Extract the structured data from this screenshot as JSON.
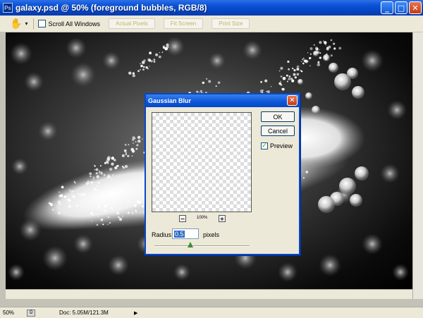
{
  "window": {
    "title": "galaxy.psd @ 50% (foreground bubbles, RGB/8)",
    "app_icon_text": "Ps",
    "minimize_glyph": "_",
    "maximize_glyph": "□",
    "close_glyph": "✕"
  },
  "options_bar": {
    "tool_icon": "hand-tool-icon",
    "tool_glyph": "✋",
    "dropdown_glyph": "▾",
    "scroll_all_windows_label": "Scroll All Windows",
    "scroll_all_windows_checked": false,
    "buttons": [
      {
        "label": "Actual Pixels"
      },
      {
        "label": "Fit Screen"
      },
      {
        "label": "Print Size"
      }
    ]
  },
  "dialog": {
    "title": "Gaussian Blur",
    "close_glyph": "✕",
    "ok_label": "OK",
    "cancel_label": "Cancel",
    "preview_label": "Preview",
    "preview_checked": true,
    "check_glyph": "✓",
    "zoom_out_glyph": "−",
    "zoom_in_glyph": "+",
    "zoom_percent": "100%",
    "radius_label": "Radius:",
    "radius_value": "0.5",
    "radius_unit": "pixels",
    "radius_slider_level": 0.38
  },
  "status_bar": {
    "zoom": "50%",
    "doc_info": "Doc: 5.05M/121.3M",
    "menu_arrow": "▶"
  },
  "colors": {
    "title_blue": "#0a52d6",
    "close_red": "#c83b13",
    "chrome": "#ece9d8",
    "check_green": "#21a121"
  }
}
